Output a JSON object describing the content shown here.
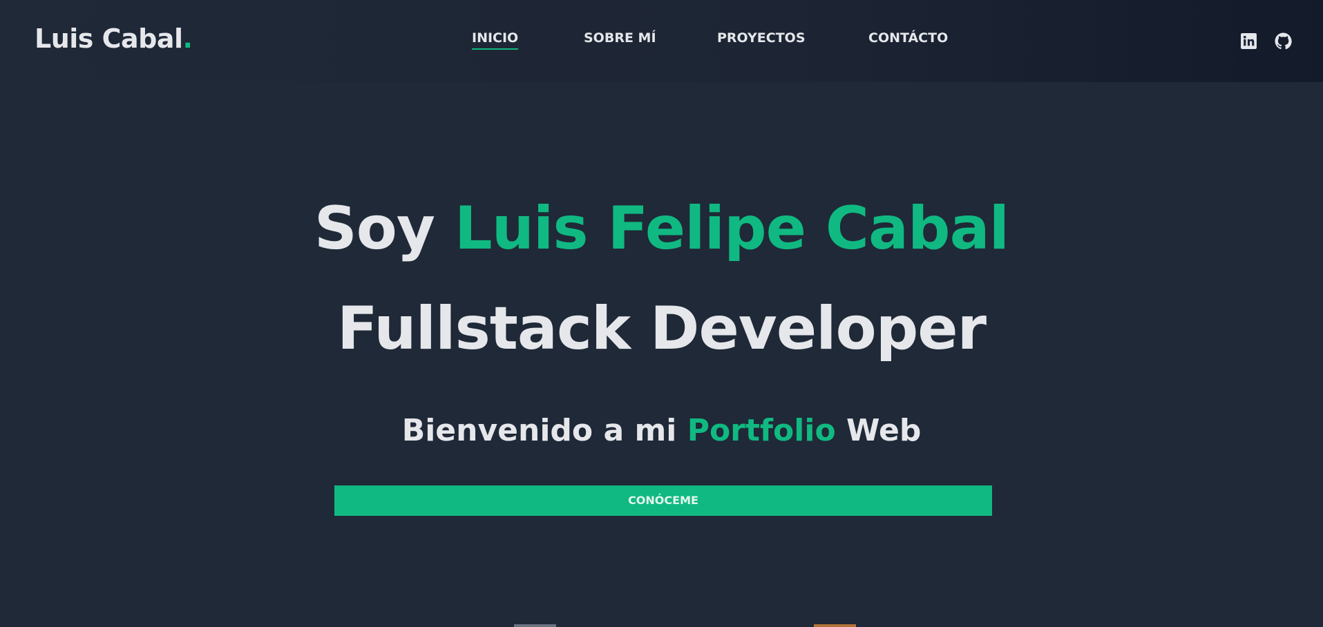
{
  "header": {
    "logo_text": "Luis Cabal",
    "logo_dot": ".",
    "nav": [
      {
        "label": "INICIO",
        "active": true
      },
      {
        "label": "SOBRE MÍ",
        "active": false
      },
      {
        "label": "PROYECTOS",
        "active": false
      },
      {
        "label": "CONTÁCTO",
        "active": false
      }
    ],
    "social": [
      {
        "icon": "linkedin-icon"
      },
      {
        "icon": "github-icon"
      }
    ]
  },
  "hero": {
    "line1_prefix": "Soy ",
    "line1_name": "Luis Felipe Cabal",
    "line2": "Fullstack Developer",
    "sub_prefix": "Bienvenido a mi ",
    "sub_highlight": "Portfolio",
    "sub_suffix": " Web",
    "cta_label": "CONÓCEME"
  },
  "colors": {
    "background": "#1f2937",
    "accent": "#10b981",
    "text": "#e5e7eb"
  }
}
